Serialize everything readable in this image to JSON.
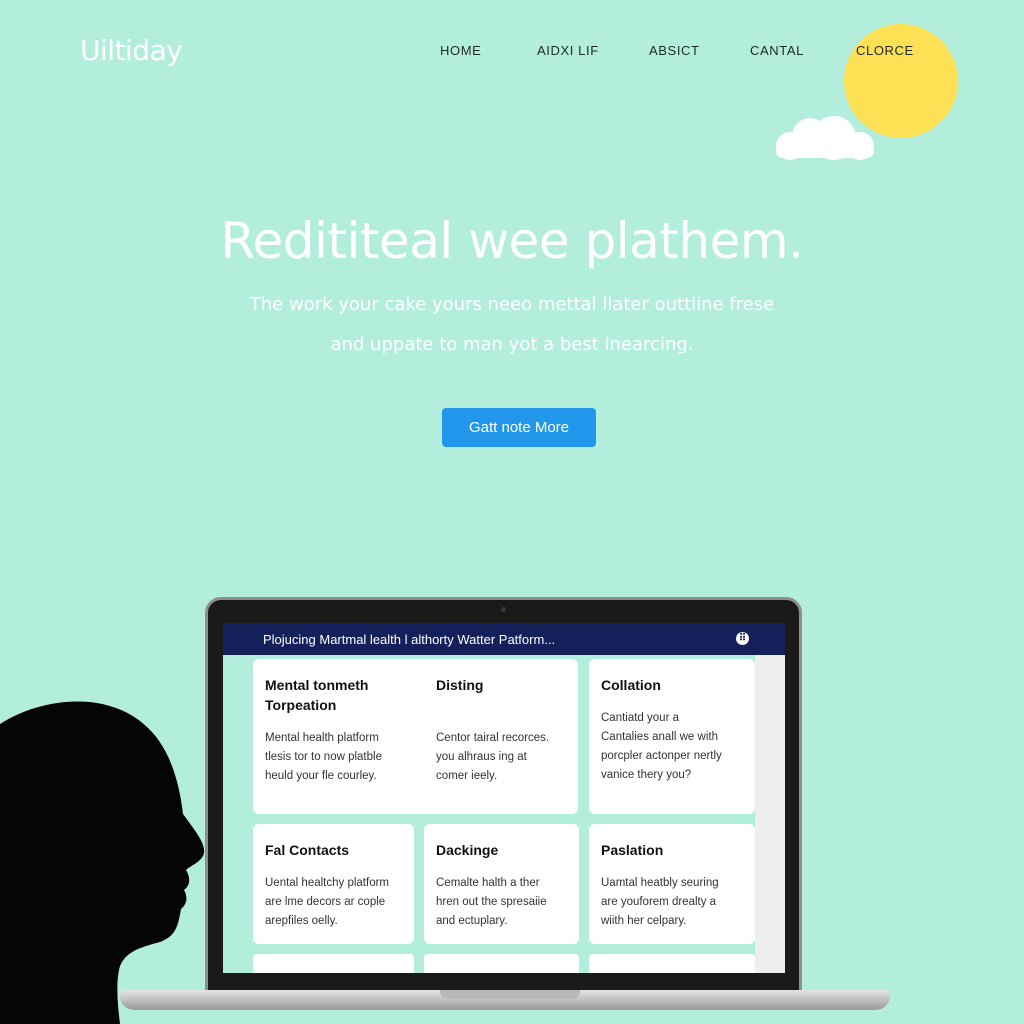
{
  "logo": "Uiltiday",
  "nav": [
    "HOME",
    "AIDXI LIF",
    "ABSICT",
    "CANTAL",
    "CLORCE"
  ],
  "hero": {
    "title": "Redititeal wee plathem.",
    "subtitle_line1": "The work your cake yours neeo mettal llater outtline frese",
    "subtitle_line2": "and uppate to man yot a best inearcing.",
    "cta": "Gatt note More"
  },
  "laptop": {
    "bar_title": "Plojucing Martmal lealth l althorty Watter Patform...",
    "cards": [
      {
        "title": "Mental tonmeth Torpeation",
        "body": [
          "Mental health platform",
          "tlesis tor to now platble",
          "heuld your fle courley."
        ]
      },
      {
        "title": "Disting",
        "body": [
          "Centor tairal recorces.",
          "you alhraus ing at",
          "comer ieely."
        ]
      },
      {
        "title": "Collation",
        "body": [
          "Cantiatd your a",
          "Cantalies anall we with",
          "porcpler actonper nertly",
          "vanice thery you?"
        ]
      },
      {
        "title": "Fal Contacts",
        "body": [
          "Uental healtchy platform",
          "are lme decors ar cople",
          "arepfiles oelly."
        ]
      },
      {
        "title": "Dackinge",
        "body": [
          "Cemalte halth a ther",
          "hren out the spresaiie",
          "and ectuplary."
        ]
      },
      {
        "title": "Paslation",
        "body": [
          "Uamtal heatbly seuring",
          "are youforem drealty a",
          "wiith her celpary."
        ]
      }
    ]
  },
  "colors": {
    "background": "#b3eedc",
    "accent": "#2196ea",
    "sun": "#fde054",
    "bar": "#14205a"
  }
}
